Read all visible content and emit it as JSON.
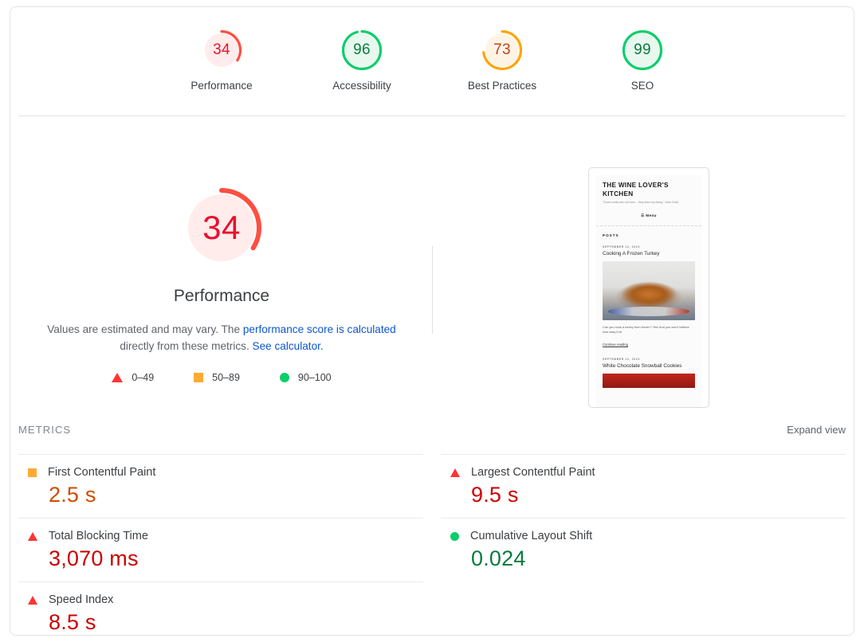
{
  "report": {
    "category_scores": [
      {
        "id": "performance",
        "label": "Performance",
        "score": 34,
        "color": "#ff4e42",
        "track": "#ffeceb",
        "text_color": "#e8112d"
      },
      {
        "id": "accessibility",
        "label": "Accessibility",
        "score": 96,
        "color": "#0cce6b",
        "track": "#e8f8ef",
        "text_color": "#0a7c3e"
      },
      {
        "id": "best-practices",
        "label": "Best Practices",
        "score": 73,
        "color": "#ffa400",
        "track": "#fdf4e6",
        "text_color": "#c4421a"
      },
      {
        "id": "seo",
        "label": "SEO",
        "score": 99,
        "color": "#0cce6b",
        "track": "#e8f8ef",
        "text_color": "#0a7c3e"
      }
    ],
    "hero": {
      "score": 34,
      "title": "Performance",
      "description_part1": "Values are estimated and may vary. The ",
      "description_link1": "performance score is calculated",
      "description_part2": " directly from these metrics.",
      "description_link2": "See calculator.",
      "gauge_color": "#ff4e42",
      "gauge_track": "#ffeceb"
    },
    "legend": [
      {
        "shape": "triangle",
        "range": "0–49",
        "color": "#ff3333"
      },
      {
        "shape": "square",
        "range": "50–89",
        "color": "#ffaa33"
      },
      {
        "shape": "circle",
        "range": "90–100",
        "color": "#0cce6b"
      }
    ],
    "metrics_header": {
      "title": "METRICS",
      "expand_view": "Expand view"
    },
    "metrics": {
      "left_column": [
        {
          "icon": "square",
          "name": "First Contentful Paint",
          "value": "2.5 s",
          "value_class": "orange"
        },
        {
          "icon": "triangle",
          "name": "Total Blocking Time",
          "value": "3,070 ms",
          "value_class": "red"
        },
        {
          "icon": "triangle",
          "name": "Speed Index",
          "value": "8.5 s",
          "value_class": "red"
        }
      ],
      "right_column": [
        {
          "icon": "triangle",
          "name": "Largest Contentful Paint",
          "value": "9.5 s",
          "value_class": "red"
        },
        {
          "icon": "circle",
          "name": "Cumulative Layout Shift",
          "value": "0.024",
          "value_class": "green"
        }
      ]
    },
    "screenshot_thumbnail": {
      "site_title": "THE WINE LOVER'S KITCHEN",
      "tagline": "\"Good cooks are not born... they learn by doing.\" Julia Child",
      "menu_label": "☰ Menu",
      "posts_heading": "POSTS",
      "post1_date": "SEPTEMBER 12, 2023",
      "post1_title": "Cooking A Frozen Turkey",
      "post1_excerpt": "Can you cook a turkey from frozen? Yes! And you won't believe how easy it is!",
      "post1_link": "Continue reading",
      "post2_date": "SEPTEMBER 12, 2023",
      "post2_title": "White Chocolate Snowball Cookies"
    }
  }
}
